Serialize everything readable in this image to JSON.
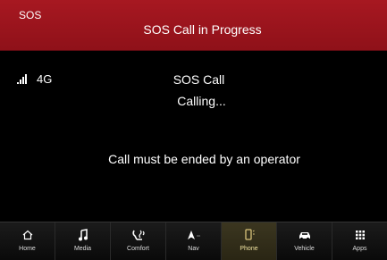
{
  "header": {
    "tag": "SOS",
    "title": "SOS Call in Progress"
  },
  "status": {
    "network": "4G"
  },
  "call": {
    "title": "SOS Call",
    "status": "Calling...",
    "note": "Call must be ended by an operator"
  },
  "navbar": {
    "items": [
      {
        "label": "Home",
        "icon": "home-icon"
      },
      {
        "label": "Media",
        "icon": "music-note-icon"
      },
      {
        "label": "Comfort",
        "icon": "seat-comfort-icon"
      },
      {
        "label": "Nav",
        "icon": "navigation-arrow-icon"
      },
      {
        "label": "Phone",
        "icon": "phone-icon"
      },
      {
        "label": "Vehicle",
        "icon": "car-icon"
      },
      {
        "label": "Apps",
        "icon": "apps-grid-icon"
      }
    ]
  },
  "colors": {
    "header_red": "#a71821",
    "active_tab": "#d8c27a"
  }
}
